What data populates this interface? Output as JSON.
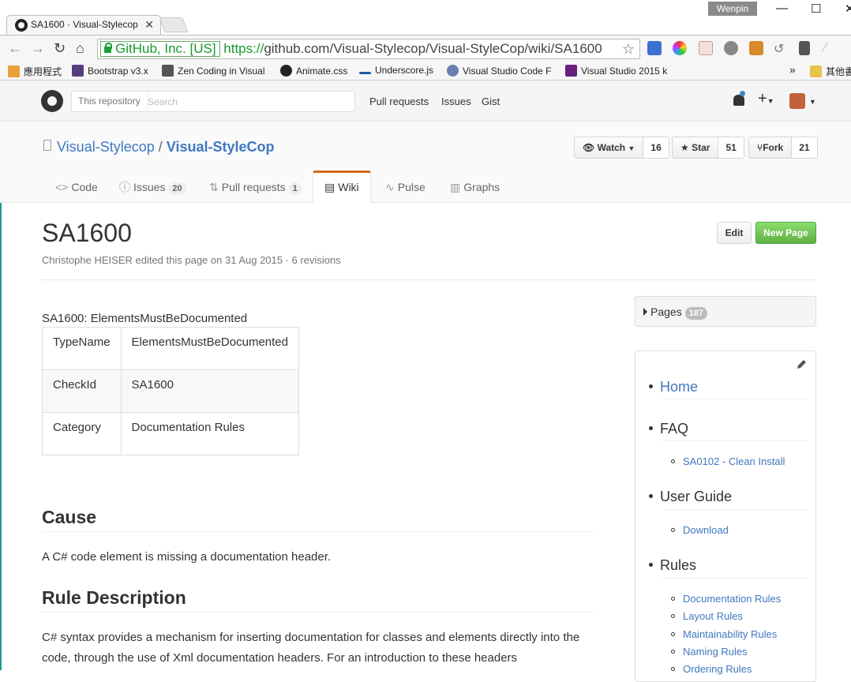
{
  "browser": {
    "tab_title": "SA1600 · Visual-Stylecop",
    "tab_close": "✕",
    "user_badge": "Wenpin",
    "minimize": "—",
    "maximize": "☐",
    "close_window": "✕",
    "secure_label": "GitHub, Inc. [US]",
    "url_scheme": "https://",
    "url_rest": "github.com/Visual-Stylecop/Visual-StyleCop/wiki/SA1600",
    "bookmarks": [
      {
        "label": "應用程式",
        "icon": "apps-icon",
        "color": "#e8a23b"
      },
      {
        "label": "Bootstrap v3.x",
        "icon": "bootstrap-icon",
        "color": "#563d7c"
      },
      {
        "label": "Zen Coding in Visual",
        "icon": "zen-icon",
        "color": "#555555"
      },
      {
        "label": "Animate.css",
        "icon": "github-icon",
        "color": "#222222"
      },
      {
        "label": "Underscore.js",
        "icon": "underscore-icon",
        "color": "#1f5aa6"
      },
      {
        "label": "Visual Studio Code F",
        "icon": "person-icon",
        "color": "#6a7fb0"
      },
      {
        "label": "Visual Studio 2015 k",
        "icon": "vs-icon",
        "color": "#68217a"
      }
    ],
    "bookmarks_more": "»",
    "other_bookmarks": "其他書"
  },
  "gh": {
    "search_scope": "This repository",
    "search_placeholder": "Search",
    "nav": [
      "Pull requests",
      "Issues",
      "Gist"
    ]
  },
  "repo": {
    "owner": "Visual-Stylecop",
    "separator": "/",
    "name": "Visual-StyleCop",
    "watch_label": "Watch",
    "watch_count": "16",
    "star_label": "Star",
    "star_count": "51",
    "fork_label": "Fork",
    "fork_count": "21",
    "tabs": {
      "code": "Code",
      "issues": "Issues",
      "issues_count": "20",
      "pulls": "Pull requests",
      "pulls_count": "1",
      "wiki": "Wiki",
      "pulse": "Pulse",
      "graphs": "Graphs"
    }
  },
  "page": {
    "title": "SA1600",
    "meta": "Christophe HEISER edited this page on 31 Aug 2015 · 6 revisions",
    "edit_label": "Edit",
    "new_page_label": "New Page",
    "rule_line": "SA1600: ElementsMustBeDocumented",
    "table": [
      [
        "TypeName",
        "ElementsMustBeDocumented"
      ],
      [
        "CheckId",
        "SA1600"
      ],
      [
        "Category",
        "Documentation Rules"
      ]
    ],
    "cause_heading": "Cause",
    "cause_text": "A C# code element is missing a documentation header.",
    "rule_desc_heading": "Rule Description",
    "rule_desc_text": "C# syntax provides a mechanism for inserting documentation for classes and elements directly into the code, through the use of Xml documentation headers. For an introduction to these headers"
  },
  "sidebar": {
    "pages_label": "Pages",
    "pages_count": "187",
    "home": "Home",
    "faq": "FAQ",
    "faq_items": [
      "SA0102 - Clean Install"
    ],
    "user_guide": "User Guide",
    "user_guide_items": [
      "Download"
    ],
    "rules": "Rules",
    "rules_items": [
      "Documentation Rules",
      "Layout Rules",
      "Maintainability Rules",
      "Naming Rules",
      "Ordering Rules"
    ]
  }
}
